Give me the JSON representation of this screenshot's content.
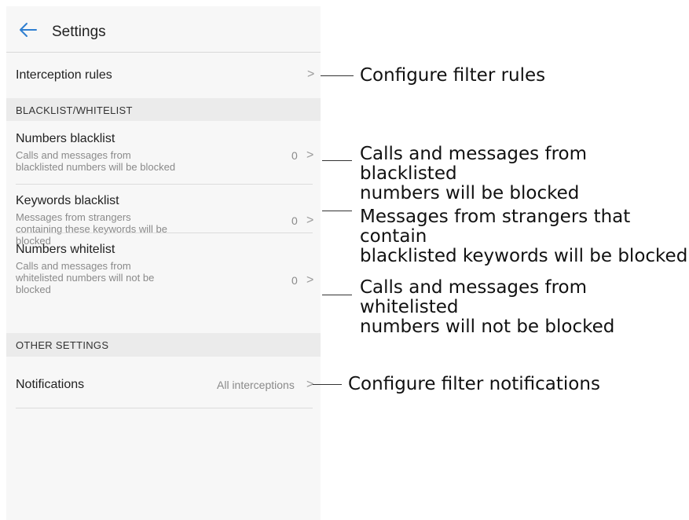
{
  "header": {
    "title": "Settings",
    "back_icon": "arrow-left-icon"
  },
  "rows": {
    "interception": {
      "label": "Interception rules",
      "chevron": ">"
    },
    "numbers_blacklist": {
      "label": "Numbers blacklist",
      "sub_line1": "Calls and messages from",
      "sub_line2": "blacklisted numbers will be blocked",
      "value": "0",
      "chevron": ">"
    },
    "keywords_blacklist": {
      "label": "Keywords blacklist",
      "sub_line1": "Messages from strangers",
      "sub_line2": "containing these keywords will be",
      "sub_line3": "blocked",
      "value": "0",
      "chevron": ">"
    },
    "numbers_whitelist": {
      "label": "Numbers whitelist",
      "sub_line1": "Calls and messages from",
      "sub_line2": "whitelisted numbers will not be",
      "sub_line3": "blocked",
      "value": "0",
      "chevron": ">"
    },
    "notifications": {
      "label": "Notifications",
      "value": "All interceptions",
      "chevron": ">"
    }
  },
  "sections": {
    "blacklist_whitelist": "BLACKLIST/WHITELIST",
    "other_settings": "OTHER SETTINGS"
  },
  "annotations": {
    "interception": {
      "line1": "Configure filter rules"
    },
    "numbers_blacklist": {
      "line1": "Calls and messages from blacklisted",
      "line2": "numbers will be blocked"
    },
    "keywords_blacklist": {
      "line1": "Messages from strangers that contain",
      "line2": "blacklisted keywords will be blocked"
    },
    "numbers_whitelist": {
      "line1": "Calls and messages from whitelisted",
      "line2": "numbers will not be blocked"
    },
    "notifications": {
      "line1": "Configure filter notifications"
    }
  }
}
